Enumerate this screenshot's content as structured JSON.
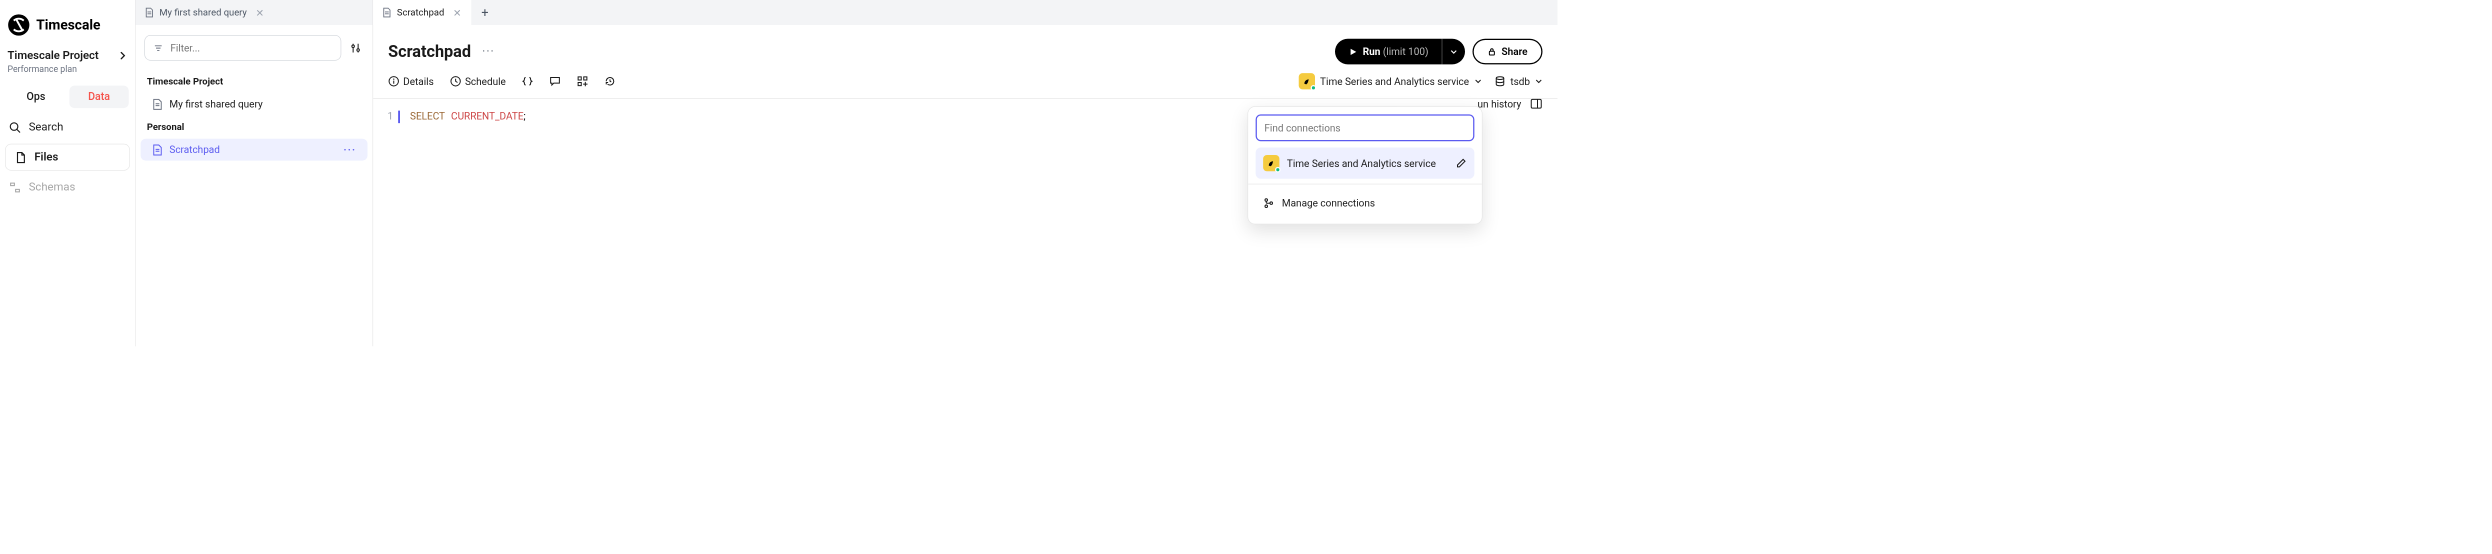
{
  "brand": "Timescale",
  "project": {
    "name": "Timescale Project",
    "plan": "Performance plan"
  },
  "left_toggle": {
    "ops": "Ops",
    "data": "Data"
  },
  "nav": {
    "search": "Search",
    "files": "Files",
    "schemas": "Schemas"
  },
  "tabs": [
    {
      "label": "My first shared query",
      "active": false
    },
    {
      "label": "Scratchpad",
      "active": true
    }
  ],
  "filter": {
    "placeholder": "Filter..."
  },
  "tree": {
    "project_label": "Timescale Project",
    "project_items": [
      "My first shared query"
    ],
    "personal_label": "Personal",
    "personal_items": [
      "Scratchpad"
    ]
  },
  "header": {
    "title": "Scratchpad",
    "run_label": "Run",
    "run_limit": "(limit 100)",
    "share_label": "Share"
  },
  "toolbar": {
    "details": "Details",
    "schedule": "Schedule",
    "connection": "Time Series and Analytics service",
    "db": "tsdb"
  },
  "editor": {
    "line_no": "1",
    "select_kw": "SELECT",
    "date_kw": "CURRENT_DATE",
    "tail": ";"
  },
  "run_history_label": "un history",
  "popover": {
    "search_placeholder": "Find connections",
    "item": "Time Series and Analytics service",
    "manage": "Manage connections"
  }
}
